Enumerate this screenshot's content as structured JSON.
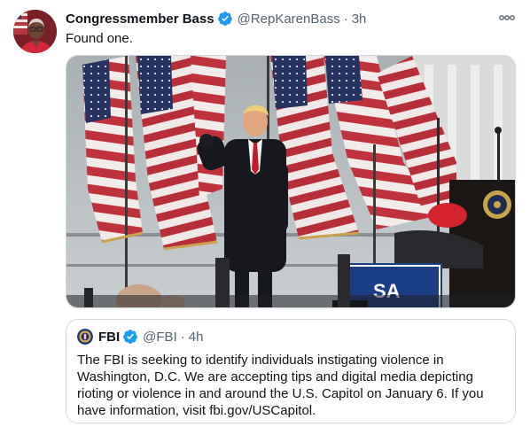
{
  "tweet": {
    "author": {
      "display_name": "Congressmember Bass",
      "handle": "@RepKarenBass",
      "verified": true,
      "avatar_icon": "profile-photo"
    },
    "separator": "·",
    "time": "3h",
    "more_icon": "more-options-icon",
    "text": "Found one.",
    "media": {
      "type": "photo",
      "overlay_text": "SA"
    }
  },
  "quoted_tweet": {
    "author": {
      "display_name": "FBI",
      "handle": "@FBI",
      "verified": true,
      "avatar_icon": "fbi-seal"
    },
    "separator": "·",
    "time": "4h",
    "text": "The FBI is seeking to identify individuals instigating violence in Washington, D.C. We are accepting tips and digital media depicting rioting or violence in and around the U.S. Capitol on January 6. If you have information, visit fbi.gov/USCapitol."
  },
  "colors": {
    "verified_badge": "#1d9bf0",
    "secondary_text": "#536471",
    "primary_text": "#0f1419",
    "border": "#cfd9de"
  }
}
